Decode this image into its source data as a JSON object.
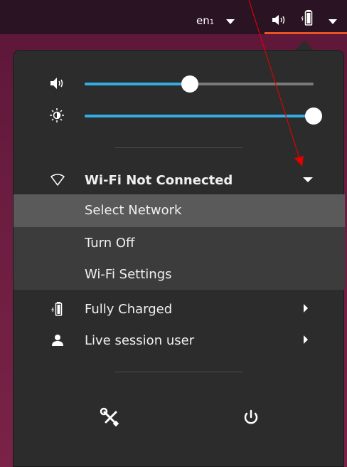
{
  "topbar": {
    "language": "en",
    "language_subscript": "1"
  },
  "sliders": {
    "volume_level": 0.46,
    "brightness_level": 1.0
  },
  "wifi": {
    "label": "Wi-Fi Not Connected",
    "submenu": [
      {
        "label": "Select Network"
      },
      {
        "label": "Turn Off"
      },
      {
        "label": "Wi-Fi Settings"
      }
    ]
  },
  "battery": {
    "label": "Fully Charged"
  },
  "user": {
    "label": "Live session user"
  },
  "icons": {
    "volume": "speaker-icon",
    "brightness": "brightness-icon",
    "wifi": "wifi-icon",
    "battery": "battery-icon",
    "user": "user-icon",
    "settings": "settings-tools-icon",
    "power": "power-icon"
  },
  "colors": {
    "accent": "#33aee5",
    "topbar_underline": "#e95420",
    "annotation": "#e00000"
  }
}
